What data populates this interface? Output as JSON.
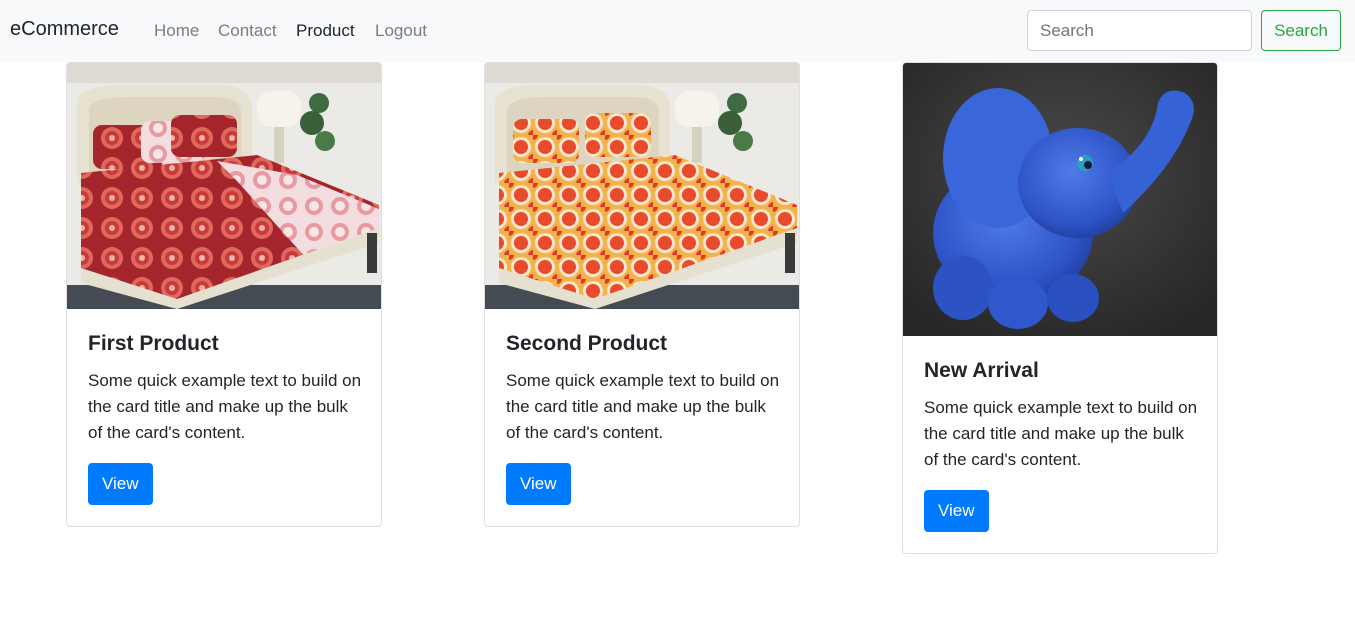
{
  "navbar": {
    "brand": "eCommerce",
    "links": [
      {
        "label": "Home",
        "active": false
      },
      {
        "label": "Contact",
        "active": false
      },
      {
        "label": "Product",
        "active": true
      },
      {
        "label": "Logout",
        "active": false
      }
    ],
    "search": {
      "placeholder": "Search",
      "button_label": "Search"
    }
  },
  "colors": {
    "navbar_bg": "#f8f9fa",
    "primary": "#007bff",
    "success": "#28a745"
  },
  "products": [
    {
      "title": "First Product",
      "text": "Some quick example text to build on the card title and make up the bulk of the card's content.",
      "button_label": "View",
      "image": "red-bedsheet-bed-photo"
    },
    {
      "title": "Second Product",
      "text": "Some quick example text to build on the card title and make up the bulk of the card's content.",
      "button_label": "View",
      "image": "orange-circle-bedsheet-bed-photo"
    },
    {
      "title": "New Arrival",
      "text": "Some quick example text to build on the card title and make up the bulk of the card's content.",
      "button_label": "View",
      "image": "blue-plush-elephant-photo"
    }
  ]
}
